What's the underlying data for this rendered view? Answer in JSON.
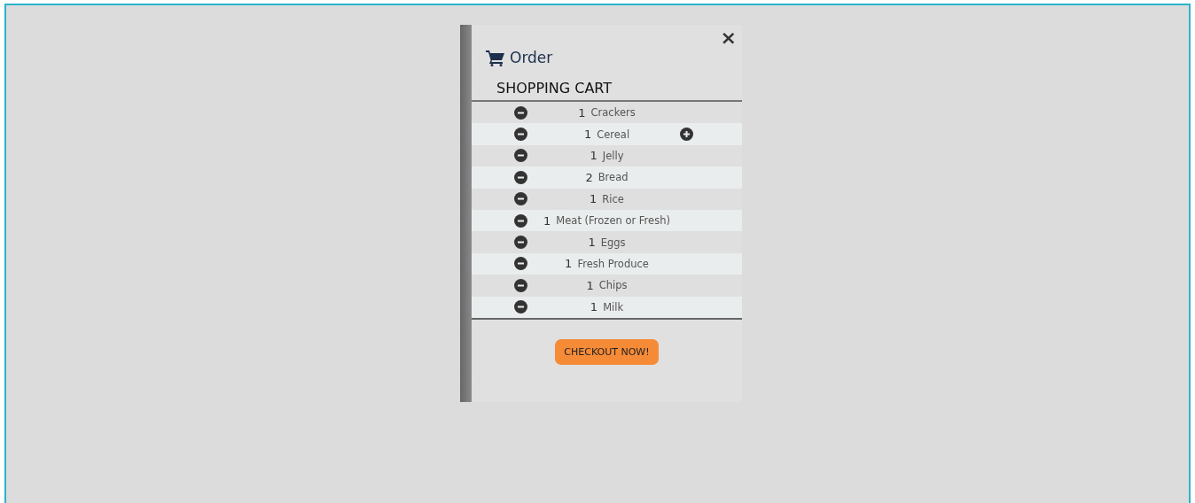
{
  "header": {
    "title": "Order",
    "close": "×"
  },
  "cart": {
    "heading": "SHOPPING CART",
    "items": [
      {
        "qty": "1",
        "name": "Crackers",
        "hovered": false
      },
      {
        "qty": "1",
        "name": "Cereal",
        "hovered": true
      },
      {
        "qty": "1",
        "name": "Jelly",
        "hovered": false
      },
      {
        "qty": "2",
        "name": "Bread",
        "hovered": false
      },
      {
        "qty": "1",
        "name": "Rice",
        "hovered": false
      },
      {
        "qty": "1",
        "name": "Meat (Frozen or Fresh)",
        "hovered": false
      },
      {
        "qty": "1",
        "name": "Eggs",
        "hovered": false
      },
      {
        "qty": "1",
        "name": "Fresh Produce",
        "hovered": false
      },
      {
        "qty": "1",
        "name": "Chips",
        "hovered": false
      },
      {
        "qty": "1",
        "name": "Milk",
        "hovered": false
      }
    ]
  },
  "checkout": {
    "label": "CHECKOUT NOW!"
  }
}
